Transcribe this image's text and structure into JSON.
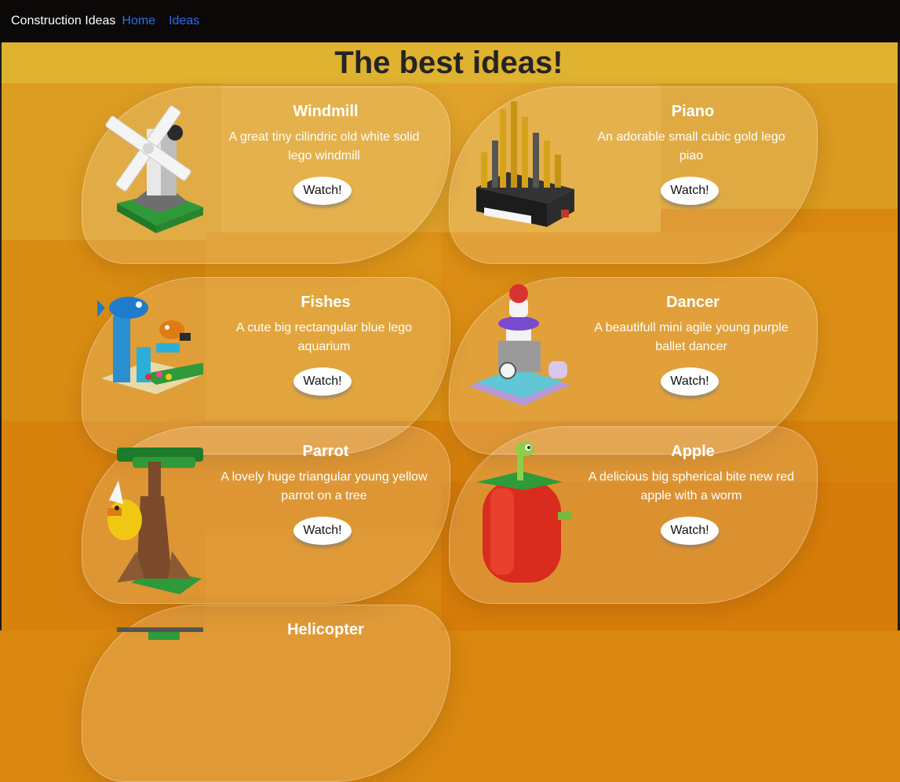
{
  "navbar": {
    "brand": "Construction Ideas",
    "home": "Home",
    "ideas": "Ideas"
  },
  "page": {
    "title": "The best ideas!"
  },
  "cards": [
    {
      "name": "Windmill",
      "description": "A great tiny cilindric old white solid lego windmill",
      "button": "Watch!"
    },
    {
      "name": "Piano",
      "description": "An adorable small cubic gold lego piao",
      "button": "Watch!"
    },
    {
      "name": "Fishes",
      "description": "A cute big rectangular blue lego aquarium",
      "button": "Watch!"
    },
    {
      "name": "Dancer",
      "description": "A beautifull mini agile young purple ballet dancer",
      "button": "Watch!"
    },
    {
      "name": "Parrot",
      "description": "A lovely huge triangular young yellow parrot on a tree",
      "button": "Watch!"
    },
    {
      "name": "Apple",
      "description": "A delicious big spherical bite new red apple with a worm",
      "button": "Watch!"
    },
    {
      "name": "Helicopter"
    }
  ]
}
